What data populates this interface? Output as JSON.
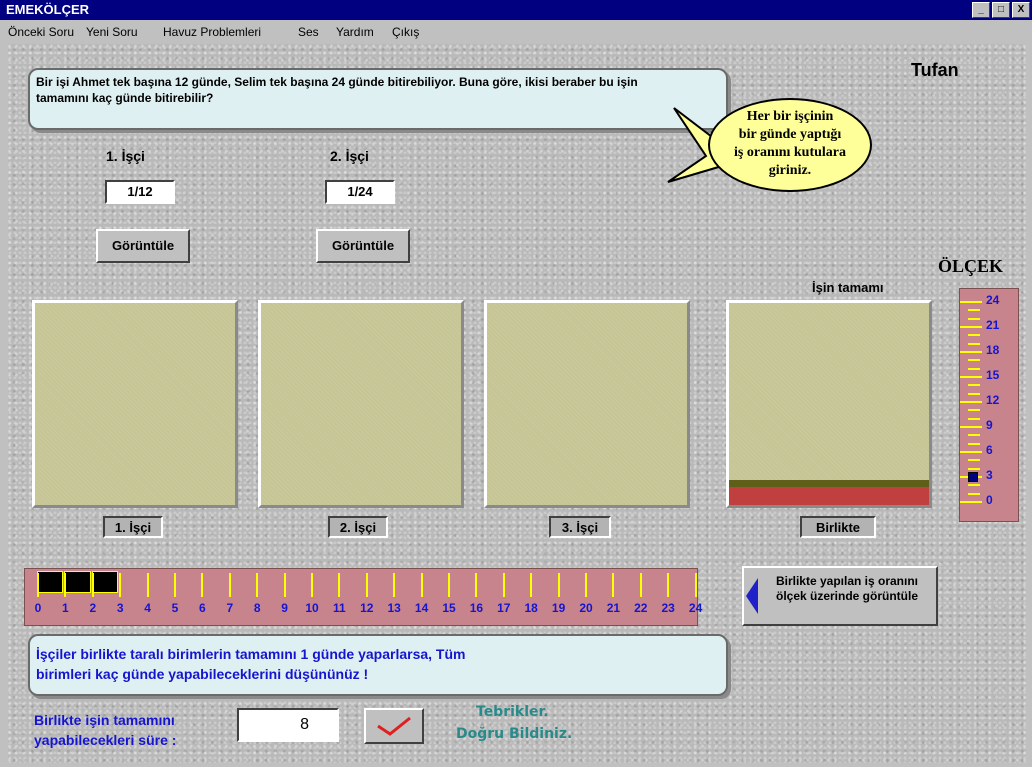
{
  "window": {
    "title": "EMEKÖLÇER",
    "controls": [
      "_",
      "□",
      "X"
    ]
  },
  "menu": [
    "Önceki Soru",
    "Yeni Soru",
    "Havuz Problemleri",
    "Ses",
    "Yardım",
    "Çıkış"
  ],
  "question": "Bir işi Ahmet tek başına 12 günde, Selim tek başına 24 günde bitirebiliyor. Buna göre, ikisi beraber bu işin tamamını kaç günde bitirebilir?",
  "username": "Tufan",
  "hint": [
    "Her bir işçinin",
    "bir günde yaptığı",
    "iş oranını kutulara",
    "giriniz."
  ],
  "workers": [
    {
      "label": "1. İşçi",
      "ratio": "1/12",
      "button": "Görüntüle"
    },
    {
      "label": "2. İşçi",
      "ratio": "1/24",
      "button": "Görüntüle"
    }
  ],
  "boxes": [
    "1. İşçi",
    "2. İşçi",
    "3. İşçi",
    "Birlikte"
  ],
  "whole_label": "İşin tamamı",
  "scale_title": "ÖLÇEK",
  "vscale_labels": [
    "24",
    "21",
    "18",
    "15",
    "12",
    "9",
    "6",
    "3",
    "0"
  ],
  "vscale_marker_value": 3,
  "numline_labels": [
    "0",
    "1",
    "2",
    "3",
    "4",
    "5",
    "6",
    "7",
    "8",
    "9",
    "10",
    "11",
    "12",
    "13",
    "14",
    "15",
    "16",
    "17",
    "18",
    "19",
    "20",
    "21",
    "22",
    "23",
    "24"
  ],
  "numline_filled_units": 3,
  "birlikte_fill_units": 3,
  "show_scale_button": "Birlikte yapılan iş oranını ölçek üzerinde görüntüle",
  "info": "İşçiler birlikte taralı birimlerin tamamını 1 günde yaparlarsa, Tüm birimleri kaç günde yapabileceklerini düşününüz !",
  "answer_label": [
    "Birlikte işin tamamını",
    "yapabilecekleri süre :"
  ],
  "answer_value": "8",
  "congrats": [
    "Tebrikler.",
    "Doğru Bildiniz."
  ],
  "colors": {
    "box": "#c6c595",
    "scale": "#c8848c",
    "tick": "#ffff00",
    "num": "#1515d0",
    "fill_dark": "#5f5f1a",
    "fill_red": "#c04040"
  }
}
